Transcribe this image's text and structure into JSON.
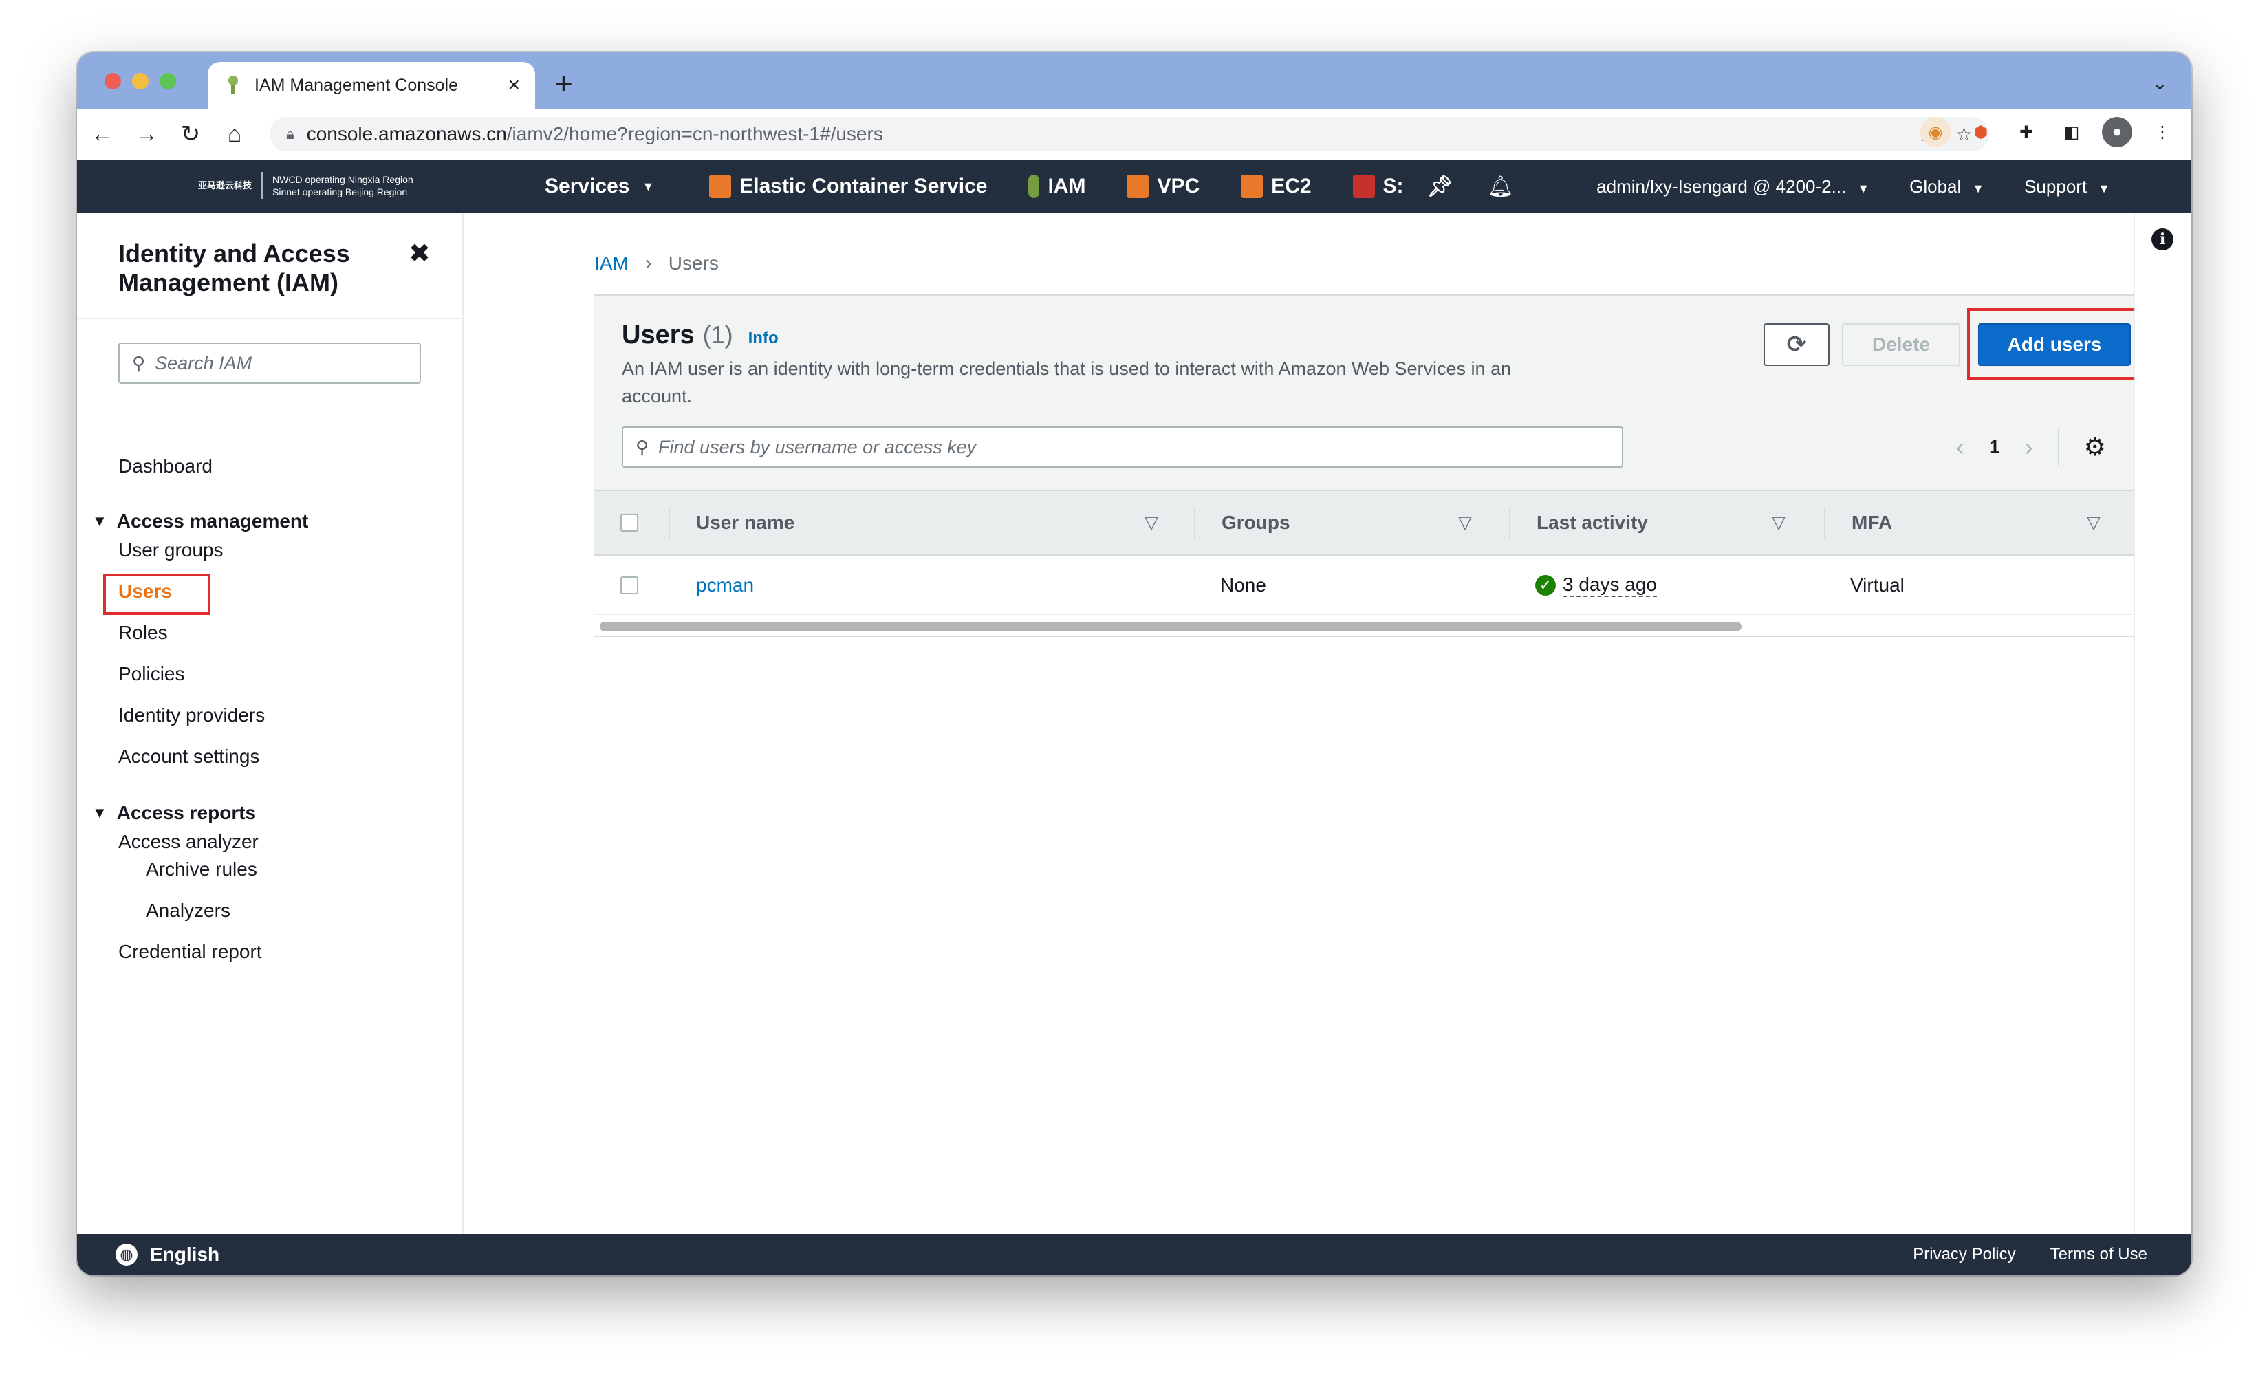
{
  "browser": {
    "tab_title": "IAM Management Console",
    "new_tab": "+",
    "url_host": "console.amazonaws.cn",
    "url_path": "/iamv2/home?region=cn-northwest-1#/users"
  },
  "aws_nav": {
    "logo_mark": "亚马逊云科技",
    "logo_line1": "NWCD operating Ningxia Region",
    "logo_line2": "Sinnet operating Beijing Region",
    "services_label": "Services",
    "favorites": [
      {
        "label": "Elastic Container Service",
        "color": "#e8792a"
      },
      {
        "label": "IAM",
        "color": "#759c3e"
      },
      {
        "label": "VPC",
        "color": "#e8792a"
      },
      {
        "label": "EC2",
        "color": "#e8792a"
      },
      {
        "label": "S:",
        "color": "#c7312d"
      }
    ],
    "account": "admin/lxy-Isengard @ 4200-2...",
    "region": "Global",
    "support": "Support"
  },
  "sidebar": {
    "title": "Identity and Access Management (IAM)",
    "search_placeholder": "Search IAM",
    "dashboard": "Dashboard",
    "section_access_management": "Access management",
    "user_groups": "User groups",
    "users": "Users",
    "roles": "Roles",
    "policies": "Policies",
    "identity_providers": "Identity providers",
    "account_settings": "Account settings",
    "section_access_reports": "Access reports",
    "access_analyzer": "Access analyzer",
    "archive_rules": "Archive rules",
    "analyzers": "Analyzers",
    "credential_report": "Credential report"
  },
  "breadcrumb": {
    "root": "IAM",
    "current": "Users"
  },
  "users_panel": {
    "title": "Users",
    "count": "(1)",
    "info": "Info",
    "description": "An IAM user is an identity with long-term credentials that is used to interact with Amazon Web Services in an account.",
    "delete_label": "Delete",
    "add_label": "Add users",
    "search_placeholder": "Find users by username or access key",
    "page_number": "1",
    "columns": [
      "User name",
      "Groups",
      "Last activity",
      "MFA"
    ],
    "rows": [
      {
        "user_name": "pcman",
        "groups": "None",
        "last_activity": "3 days ago",
        "mfa": "Virtual"
      }
    ]
  },
  "footer": {
    "language": "English",
    "privacy": "Privacy Policy",
    "terms": "Terms of Use"
  }
}
